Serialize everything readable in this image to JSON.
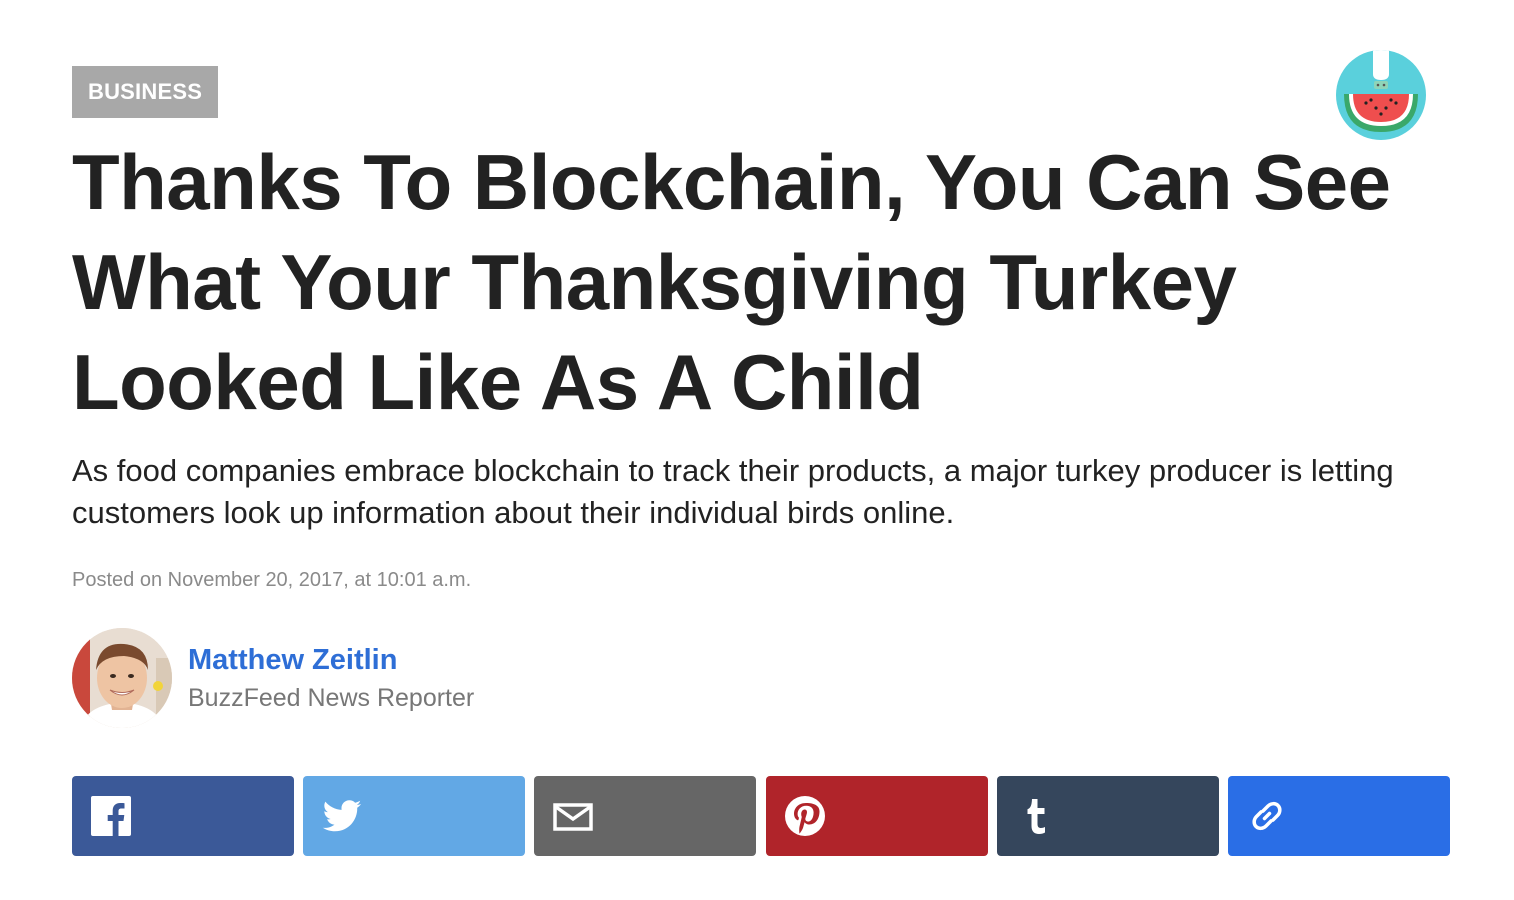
{
  "category": {
    "label": "BUSINESS",
    "color": "#a8a8a8"
  },
  "badge": {
    "icon": "watermelon-badge-icon"
  },
  "article": {
    "headline": "Thanks To Blockchain, You Can See What Your Thanksgiving Turkey Looked Like As A Child",
    "dek": "As food companies embrace blockchain to track their products, a major turkey producer is letting customers look up information about their individual birds online.",
    "timestamp": "Posted on November 20, 2017, at 10:01 a.m."
  },
  "author": {
    "name": "Matthew Zeitlin",
    "title": "BuzzFeed News Reporter",
    "name_color": "#2e6ed6"
  },
  "share": {
    "buttons": [
      {
        "id": "facebook",
        "icon": "facebook-icon",
        "color": "#3b5998"
      },
      {
        "id": "twitter",
        "icon": "twitter-icon",
        "color": "#62a8e5"
      },
      {
        "id": "email",
        "icon": "email-icon",
        "color": "#666666"
      },
      {
        "id": "pinterest",
        "icon": "pinterest-icon",
        "color": "#b0242a"
      },
      {
        "id": "tumblr",
        "icon": "tumblr-icon",
        "color": "#35465c"
      },
      {
        "id": "copy-link",
        "icon": "link-icon",
        "color": "#2a6ee6"
      }
    ]
  }
}
